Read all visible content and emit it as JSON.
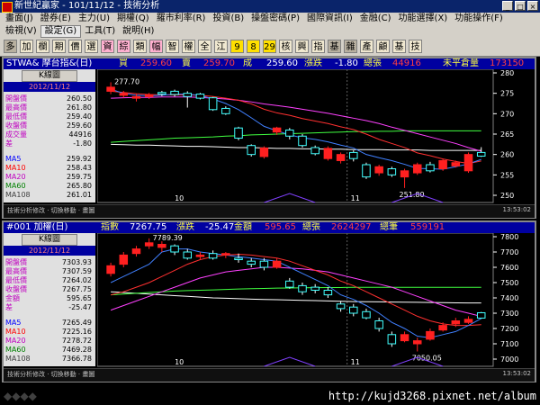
{
  "window": {
    "title": "新世紀贏家 - 101/11/12 - 技術分析",
    "minimize": "_",
    "maximize": "□",
    "close": "×"
  },
  "menu": {
    "row1": [
      "畫面(J)",
      "證券(E)",
      "主力(U)",
      "期權(Q)",
      "羅市利率(R)",
      "投資(B)",
      "操盤密碼(P)",
      "國際資訊(I)",
      "金融(C)",
      "功能選擇(X)",
      "功能操作(F)"
    ],
    "row2": [
      "檢視(V)",
      "設定(G)",
      "工具(T)",
      "說明(H)"
    ],
    "selected_row2": "設定(G)"
  },
  "toolbar": [
    "多",
    "加",
    "欄",
    "期",
    "價",
    "選",
    "資",
    "綜",
    "類",
    "幅",
    "智",
    "權",
    "全",
    "江",
    "9",
    "8",
    "29",
    "核",
    "興",
    "指",
    "基",
    "雜",
    "產",
    "顧",
    "基",
    "技"
  ],
  "colors": {
    "up": "#ff2020",
    "down": "#40ffff",
    "ma5": "#4080ff",
    "ma10": "#ff3030",
    "ma20": "#ff40ff",
    "ma60": "#40ff40",
    "ma108": "#ffffff",
    "panel_header": "#0000a0"
  },
  "top": {
    "header": {
      "symbol": "STWA& 摩台指&(日)",
      "buy_label": "買",
      "buy": "259.60",
      "sell_label": "賣",
      "sell": "259.70",
      "last_label": "成",
      "last": "259.60",
      "chg_label": "漲跌",
      "chg": "-1.80",
      "vol_label": "總張",
      "vol": "44916",
      "oi_label": "未平倉量",
      "oi": "173150"
    },
    "info": {
      "kline_button": "K線圖",
      "date": "2012/11/12",
      "rows": [
        {
          "label": "開盤價",
          "value": "260.50"
        },
        {
          "label": "最高價",
          "value": "261.80"
        },
        {
          "label": "最低價",
          "value": "259.40"
        },
        {
          "label": "收盤價",
          "value": "259.60"
        },
        {
          "label": "成交量",
          "value": "44916"
        },
        {
          "label": "差",
          "value": "-1.80"
        }
      ],
      "ma_rows": [
        {
          "label": "MA5",
          "value": "259.92"
        },
        {
          "label": "MA10",
          "value": "258.43"
        },
        {
          "label": "MA20",
          "value": "259.75"
        },
        {
          "label": "MA60",
          "value": "265.80"
        },
        {
          "label": "MA108",
          "value": "261.01"
        }
      ]
    },
    "high_label": "277.70",
    "low_label": "251.80",
    "x_labels": [
      "10",
      "11"
    ],
    "status": "技術分析修改 · 切換移動 · 畫圖",
    "time": "13:53:02"
  },
  "bottom": {
    "header": {
      "symbol": "#001 加權(日)",
      "idx_label": "指數",
      "idx": "7267.75",
      "chg_label": "漲跌",
      "chg": "-25.47",
      "amt_label": "金額",
      "amt": "595.65",
      "vol_label": "總張",
      "vol": "2624297",
      "cnt_label": "總筆",
      "cnt": "559191"
    },
    "info": {
      "kline_button": "K線圖",
      "date": "2012/11/12",
      "rows": [
        {
          "label": "開盤價",
          "value": "7303.93"
        },
        {
          "label": "最高價",
          "value": "7307.59"
        },
        {
          "label": "最低價",
          "value": "7264.02"
        },
        {
          "label": "收盤價",
          "value": "7267.75"
        },
        {
          "label": "金額",
          "value": "595.65"
        },
        {
          "label": "差",
          "value": "-25.47"
        }
      ],
      "ma_rows": [
        {
          "label": "MA5",
          "value": "7265.49"
        },
        {
          "label": "MA10",
          "value": "7225.16"
        },
        {
          "label": "MA20",
          "value": "7278.72"
        },
        {
          "label": "MA60",
          "value": "7469.28"
        },
        {
          "label": "MA108",
          "value": "7366.78"
        }
      ]
    },
    "high_label": "7789.39",
    "low_label": "7050.05",
    "x_labels": [
      "10",
      "11"
    ],
    "status": "技術分析修改 · 切換移動 · 畫圖",
    "time": "13:53:02"
  },
  "chart_data": [
    {
      "type": "candlestick",
      "title": "STWA& 摩台指&(日)",
      "ylim": [
        250,
        280
      ],
      "y_ticks": [
        250,
        255,
        260,
        265,
        270,
        275,
        280
      ],
      "x_ticks": [
        "10",
        "11"
      ],
      "candles": [
        {
          "o": 275.5,
          "c": 276.5,
          "h": 277.7,
          "l": 274.8
        },
        {
          "o": 274.5,
          "c": 275.0,
          "h": 275.6,
          "l": 273.9
        },
        {
          "o": 273.8,
          "c": 274.2,
          "h": 274.8,
          "l": 273.0
        },
        {
          "o": 274.2,
          "c": 274.6,
          "h": 275.1,
          "l": 273.6
        },
        {
          "o": 275.2,
          "c": 274.8,
          "h": 275.6,
          "l": 274.3
        },
        {
          "o": 275.5,
          "c": 274.7,
          "h": 275.9,
          "l": 274.2
        },
        {
          "o": 275.0,
          "c": 274.2,
          "h": 275.5,
          "l": 271.5
        },
        {
          "o": 274.8,
          "c": 273.8,
          "h": 275.1,
          "l": 273.5
        },
        {
          "o": 273.9,
          "c": 271.0,
          "h": 274.1,
          "l": 270.7
        },
        {
          "o": 271.3,
          "c": 270.0,
          "h": 271.8,
          "l": 269.7
        },
        {
          "o": 266.5,
          "c": 264.0,
          "h": 266.8,
          "l": 263.5
        },
        {
          "o": 262.2,
          "c": 260.0,
          "h": 262.5,
          "l": 259.5
        },
        {
          "o": 259.5,
          "c": 261.6,
          "h": 262.0,
          "l": 259.0
        },
        {
          "o": 265.5,
          "c": 266.5,
          "h": 266.8,
          "l": 264.8
        },
        {
          "o": 266.0,
          "c": 264.5,
          "h": 266.5,
          "l": 263.7
        },
        {
          "o": 264.5,
          "c": 262.2,
          "h": 265.0,
          "l": 261.7
        },
        {
          "o": 261.7,
          "c": 260.2,
          "h": 262.2,
          "l": 259.8
        },
        {
          "o": 259.0,
          "c": 261.5,
          "h": 262.0,
          "l": 258.5
        },
        {
          "o": 258.5,
          "c": 260.0,
          "h": 260.5,
          "l": 257.8
        },
        {
          "o": 260.5,
          "c": 259.0,
          "h": 261.0,
          "l": 258.3
        },
        {
          "o": 257.5,
          "c": 254.5,
          "h": 258.0,
          "l": 254.0
        },
        {
          "o": 255.5,
          "c": 257.0,
          "h": 257.5,
          "l": 254.8
        },
        {
          "o": 256.5,
          "c": 255.0,
          "h": 257.0,
          "l": 254.5
        },
        {
          "o": 254.5,
          "c": 256.0,
          "h": 256.5,
          "l": 251.8
        },
        {
          "o": 255.5,
          "c": 257.5,
          "h": 258.0,
          "l": 255.0
        },
        {
          "o": 257.5,
          "c": 256.0,
          "h": 258.2,
          "l": 255.6
        },
        {
          "o": 256.5,
          "c": 258.5,
          "h": 259.0,
          "l": 256.0
        },
        {
          "o": 257.2,
          "c": 258.0,
          "h": 258.5,
          "l": 256.8
        },
        {
          "o": 256.0,
          "c": 260.0,
          "h": 260.5,
          "l": 255.5
        },
        {
          "o": 260.5,
          "c": 259.6,
          "h": 261.8,
          "l": 259.4
        }
      ],
      "ma5": [
        276.0,
        275.0,
        274.5,
        274.4,
        274.5,
        274.8,
        274.8,
        274.5,
        273.6,
        272.5,
        271.0,
        269.0,
        266.9,
        265.8,
        264.8,
        264.1,
        263.7,
        263.1,
        262.3,
        261.6,
        260.0,
        259.2,
        258.5,
        257.6,
        256.6,
        256.5,
        256.4,
        257.0,
        257.7,
        258.8
      ],
      "ma10": [
        275.5,
        275.2,
        274.9,
        274.7,
        274.6,
        274.6,
        274.6,
        274.5,
        274.2,
        273.8,
        273.3,
        272.4,
        271.1,
        270.2,
        269.6,
        268.8,
        268.2,
        267.6,
        266.8,
        266.1,
        265.0,
        263.7,
        262.7,
        261.7,
        260.4,
        259.7,
        258.9,
        258.3,
        257.8,
        258.4
      ],
      "ma20": [
        273.8,
        273.9,
        274.0,
        274.0,
        274.1,
        274.1,
        274.1,
        274.0,
        273.8,
        273.6,
        273.3,
        272.9,
        272.4,
        272.0,
        271.6,
        271.1,
        270.6,
        270.1,
        269.5,
        268.9,
        268.3,
        267.6,
        266.7,
        265.9,
        265.1,
        264.3,
        263.5,
        262.7,
        261.7,
        260.8
      ],
      "ma60": [
        263.0,
        263.2,
        263.4,
        263.6,
        263.8,
        264.0,
        264.1,
        264.2,
        264.3,
        264.5,
        264.6,
        264.8,
        264.9,
        265.0,
        265.1,
        265.2,
        265.3,
        265.4,
        265.5,
        265.6,
        265.6,
        265.7,
        265.7,
        265.8,
        265.8,
        265.8,
        265.8,
        265.8,
        265.8,
        265.8
      ],
      "ma108": [
        262.5,
        262.4,
        262.3,
        262.3,
        262.2,
        262.1,
        262.0,
        262.0,
        261.9,
        261.8,
        261.7,
        261.7,
        261.6,
        261.5,
        261.5,
        261.4,
        261.4,
        261.3,
        261.3,
        261.2,
        261.2,
        261.2,
        261.1,
        261.1,
        261.1,
        261.0,
        261.0,
        261.0,
        261.0,
        261.0
      ]
    },
    {
      "type": "candlestick",
      "title": "#001 加權(日)",
      "ylim": [
        7000,
        7800
      ],
      "y_ticks": [
        7000,
        7100,
        7200,
        7300,
        7400,
        7500,
        7600,
        7700,
        7800
      ],
      "x_ticks": [
        "10",
        "11"
      ],
      "candles": [
        {
          "o": 7560,
          "c": 7610,
          "h": 7630,
          "l": 7540
        },
        {
          "o": 7620,
          "c": 7680,
          "h": 7700,
          "l": 7600
        },
        {
          "o": 7690,
          "c": 7720,
          "h": 7740,
          "l": 7670
        },
        {
          "o": 7740,
          "c": 7760,
          "h": 7789,
          "l": 7720
        },
        {
          "o": 7730,
          "c": 7750,
          "h": 7770,
          "l": 7700
        },
        {
          "o": 7740,
          "c": 7700,
          "h": 7750,
          "l": 7680
        },
        {
          "o": 7700,
          "c": 7660,
          "h": 7720,
          "l": 7650
        },
        {
          "o": 7670,
          "c": 7680,
          "h": 7700,
          "l": 7650
        },
        {
          "o": 7690,
          "c": 7660,
          "h": 7710,
          "l": 7650
        },
        {
          "o": 7680,
          "c": 7690,
          "h": 7700,
          "l": 7660
        },
        {
          "o": 7660,
          "c": 7650,
          "h": 7690,
          "l": 7630
        },
        {
          "o": 7640,
          "c": 7620,
          "h": 7660,
          "l": 7600
        },
        {
          "o": 7640,
          "c": 7600,
          "h": 7660,
          "l": 7580
        },
        {
          "o": 7600,
          "c": 7640,
          "h": 7660,
          "l": 7590
        },
        {
          "o": 7510,
          "c": 7470,
          "h": 7530,
          "l": 7460
        },
        {
          "o": 7480,
          "c": 7440,
          "h": 7500,
          "l": 7420
        },
        {
          "o": 7470,
          "c": 7450,
          "h": 7490,
          "l": 7430
        },
        {
          "o": 7450,
          "c": 7420,
          "h": 7470,
          "l": 7400
        },
        {
          "o": 7360,
          "c": 7330,
          "h": 7380,
          "l": 7310
        },
        {
          "o": 7340,
          "c": 7300,
          "h": 7360,
          "l": 7280
        },
        {
          "o": 7310,
          "c": 7270,
          "h": 7330,
          "l": 7260
        },
        {
          "o": 7250,
          "c": 7200,
          "h": 7270,
          "l": 7180
        },
        {
          "o": 7160,
          "c": 7100,
          "h": 7180,
          "l": 7080
        },
        {
          "o": 7120,
          "c": 7160,
          "h": 7180,
          "l": 7110
        },
        {
          "o": 7100,
          "c": 7120,
          "h": 7140,
          "l": 7050
        },
        {
          "o": 7130,
          "c": 7180,
          "h": 7200,
          "l": 7120
        },
        {
          "o": 7190,
          "c": 7220,
          "h": 7240,
          "l": 7180
        },
        {
          "o": 7230,
          "c": 7250,
          "h": 7270,
          "l": 7210
        },
        {
          "o": 7240,
          "c": 7260,
          "h": 7280,
          "l": 7230
        },
        {
          "o": 7303,
          "c": 7268,
          "h": 7308,
          "l": 7264
        }
      ],
      "ma5": [
        7500,
        7540,
        7580,
        7620,
        7700,
        7720,
        7720,
        7700,
        7690,
        7680,
        7670,
        7660,
        7650,
        7640,
        7600,
        7560,
        7520,
        7480,
        7420,
        7390,
        7350,
        7300,
        7240,
        7200,
        7150,
        7140,
        7160,
        7180,
        7220,
        7265
      ],
      "ma10": [
        7420,
        7440,
        7470,
        7500,
        7540,
        7580,
        7620,
        7650,
        7670,
        7680,
        7685,
        7680,
        7670,
        7660,
        7640,
        7610,
        7580,
        7550,
        7510,
        7480,
        7440,
        7400,
        7360,
        7320,
        7280,
        7250,
        7230,
        7220,
        7220,
        7225
      ],
      "ma20": [
        7320,
        7350,
        7380,
        7410,
        7440,
        7470,
        7500,
        7530,
        7550,
        7570,
        7580,
        7590,
        7600,
        7600,
        7595,
        7590,
        7580,
        7570,
        7550,
        7530,
        7510,
        7490,
        7470,
        7440,
        7410,
        7380,
        7350,
        7320,
        7300,
        7279
      ],
      "ma60": [
        7420,
        7425,
        7430,
        7435,
        7440,
        7445,
        7448,
        7450,
        7452,
        7455,
        7458,
        7460,
        7462,
        7464,
        7465,
        7466,
        7467,
        7468,
        7468,
        7469,
        7469,
        7469,
        7469,
        7469,
        7469,
        7469,
        7469,
        7469,
        7469,
        7469
      ],
      "ma108": [
        7440,
        7435,
        7430,
        7425,
        7420,
        7415,
        7410,
        7405,
        7400,
        7398,
        7395,
        7392,
        7390,
        7388,
        7386,
        7384,
        7382,
        7380,
        7378,
        7376,
        7375,
        7374,
        7373,
        7372,
        7371,
        7370,
        7369,
        7368,
        7367,
        7367
      ]
    }
  ]
}
